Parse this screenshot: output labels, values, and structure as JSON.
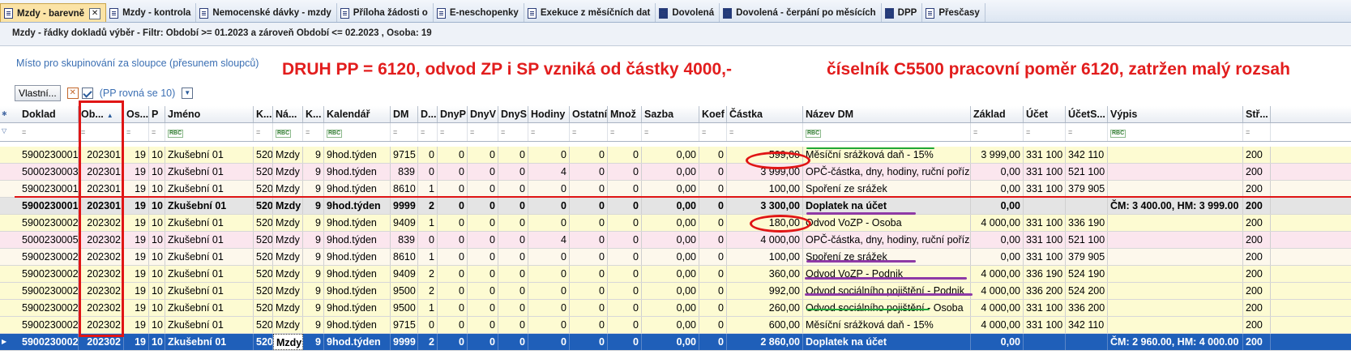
{
  "tabs": [
    {
      "label": "Mzdy - barevně",
      "active": true,
      "closable": true
    },
    {
      "label": "Mzdy - kontrola"
    },
    {
      "label": "Nemocenské dávky - mzdy"
    },
    {
      "label": "Příloha žádosti o"
    },
    {
      "label": "E-neschopenky"
    },
    {
      "label": "Exekuce z měsíčních dat"
    },
    {
      "label": "Dovolená"
    },
    {
      "label": "Dovolená - čerpání po měsících"
    },
    {
      "label": "DPP"
    },
    {
      "label": "Přesčasy"
    }
  ],
  "filter_line": "Mzdy - řádky dokladů výběr -  Filtr: Období >= 01.2023  a zároveň  Období <= 02.2023 , Osoba: 19",
  "group_zone": "Místo pro skupinování za sloupce (přesunem sloupců)",
  "annotations": {
    "note1": "DRUH PP = 6120, odvod ZP i SP vzniká od částky 4000,-",
    "note2": "číselník C5500 pracovní poměr 6120, zatržen malý rozsah"
  },
  "filterbar": {
    "custom_label": "Vlastní...",
    "clear_icon": "x-icon",
    "filter_text": "(PP rovná se 10)"
  },
  "columns": [
    "Doklad",
    "Ob...",
    "Os...",
    "P",
    "Jméno",
    "K...",
    "Ná...",
    "K...",
    "Kalendář",
    "DM",
    "D...",
    "DnyP",
    "DnyV",
    "DnyS",
    "Hodiny",
    "Ostatní",
    "Množ",
    "Sazba",
    "Koef",
    "Částka",
    "Název DM",
    "Základ",
    "Účet",
    "ÚčetS...",
    "Výpis",
    "Stř..."
  ],
  "sort": {
    "column": "Ob...",
    "direction": "ascending"
  },
  "filter_row_eq": "=",
  "filter_row_abc": "RBC",
  "rows": [
    {
      "style": "y",
      "cells": [
        "5900230001",
        "202301",
        "19",
        "10",
        "Zkušební 01",
        "520",
        "Mzdy",
        "9",
        "9hod.týden",
        "9715",
        "0",
        "0",
        "0",
        "0",
        "0",
        "0",
        "0",
        "0,00",
        "0",
        "599,00",
        "Měsíční srážková daň - 15%",
        "3 999,00",
        "331 100",
        "342 110",
        "",
        "200"
      ]
    },
    {
      "style": "p",
      "cells": [
        "5000230003",
        "202301",
        "19",
        "10",
        "Zkušební 01",
        "520",
        "Mzdy",
        "9",
        "9hod.týden",
        "839",
        "0",
        "0",
        "0",
        "0",
        "4",
        "0",
        "0",
        "0,00",
        "0",
        "3 999,00",
        "OPČ-částka, dny, hodiny, ruční pořízení",
        "0,00",
        "331 100",
        "521 100",
        "",
        "200"
      ]
    },
    {
      "style": "c",
      "cells": [
        "5900230001",
        "202301",
        "19",
        "10",
        "Zkušební 01",
        "520",
        "Mzdy",
        "9",
        "9hod.týden",
        "8610",
        "1",
        "0",
        "0",
        "0",
        "0",
        "0",
        "0",
        "0,00",
        "0",
        "100,00",
        "Spoření ze srážek",
        "0,00",
        "331 100",
        "379 905",
        "",
        "200"
      ]
    },
    {
      "style": "g",
      "cells": [
        "5900230001",
        "202301",
        "19",
        "10",
        "Zkušební 01",
        "520",
        "Mzdy",
        "9",
        "9hod.týden",
        "9999",
        "2",
        "0",
        "0",
        "0",
        "0",
        "0",
        "0",
        "0,00",
        "0",
        "3 300,00",
        "Doplatek na účet",
        "0,00",
        "",
        "",
        "ČM: 3 400.00, HM: 3 999.00",
        "200"
      ]
    },
    {
      "style": "y",
      "cells": [
        "5900230002",
        "202302",
        "19",
        "10",
        "Zkušební 01",
        "520",
        "Mzdy",
        "9",
        "9hod.týden",
        "9409",
        "1",
        "0",
        "0",
        "0",
        "0",
        "0",
        "0",
        "0,00",
        "0",
        "180,00",
        "Odvod VoZP - Osoba",
        "4 000,00",
        "331 100",
        "336 190",
        "",
        "200"
      ]
    },
    {
      "style": "p",
      "cells": [
        "5000230005",
        "202302",
        "19",
        "10",
        "Zkušební 01",
        "520",
        "Mzdy",
        "9",
        "9hod.týden",
        "839",
        "0",
        "0",
        "0",
        "0",
        "4",
        "0",
        "0",
        "0,00",
        "0",
        "4 000,00",
        "OPČ-částka, dny, hodiny, ruční pořízení",
        "0,00",
        "331 100",
        "521 100",
        "",
        "200"
      ]
    },
    {
      "style": "c",
      "cells": [
        "5900230002",
        "202302",
        "19",
        "10",
        "Zkušební 01",
        "520",
        "Mzdy",
        "9",
        "9hod.týden",
        "8610",
        "1",
        "0",
        "0",
        "0",
        "0",
        "0",
        "0",
        "0,00",
        "0",
        "100,00",
        "Spoření ze srážek",
        "0,00",
        "331 100",
        "379 905",
        "",
        "200"
      ]
    },
    {
      "style": "y",
      "cells": [
        "5900230002",
        "202302",
        "19",
        "10",
        "Zkušební 01",
        "520",
        "Mzdy",
        "9",
        "9hod.týden",
        "9409",
        "2",
        "0",
        "0",
        "0",
        "0",
        "0",
        "0",
        "0,00",
        "0",
        "360,00",
        "Odvod VoZP - Podnik",
        "4 000,00",
        "336 190",
        "524 190",
        "",
        "200"
      ]
    },
    {
      "style": "y",
      "cells": [
        "5900230002",
        "202302",
        "19",
        "10",
        "Zkušební 01",
        "520",
        "Mzdy",
        "9",
        "9hod.týden",
        "9500",
        "2",
        "0",
        "0",
        "0",
        "0",
        "0",
        "0",
        "0,00",
        "0",
        "992,00",
        "Odvod sociálního pojištění - Podnik",
        "4 000,00",
        "336 200",
        "524 200",
        "",
        "200"
      ]
    },
    {
      "style": "y",
      "cells": [
        "5900230002",
        "202302",
        "19",
        "10",
        "Zkušební 01",
        "520",
        "Mzdy",
        "9",
        "9hod.týden",
        "9500",
        "1",
        "0",
        "0",
        "0",
        "0",
        "0",
        "0",
        "0,00",
        "0",
        "260,00",
        "Odvod sociálního pojištění - Osoba",
        "4 000,00",
        "331 100",
        "336 200",
        "",
        "200"
      ]
    },
    {
      "style": "y",
      "cells": [
        "5900230002",
        "202302",
        "19",
        "10",
        "Zkušební 01",
        "520",
        "Mzdy",
        "9",
        "9hod.týden",
        "9715",
        "0",
        "0",
        "0",
        "0",
        "0",
        "0",
        "0",
        "0,00",
        "0",
        "600,00",
        "Měsíční srážková daň - 15%",
        "4 000,00",
        "331 100",
        "342 110",
        "",
        "200"
      ]
    },
    {
      "style": "sel",
      "cells": [
        "5900230002",
        "202302",
        "19",
        "10",
        "Zkušební 01",
        "520",
        "Mzdy",
        "9",
        "9hod.týden",
        "9999",
        "2",
        "0",
        "0",
        "0",
        "0",
        "0",
        "0",
        "0,00",
        "0",
        "2 860,00",
        "Doplatek na účet",
        "0,00",
        "",
        "",
        "ČM: 2 960.00, HM: 4 000.00",
        "200"
      ]
    }
  ],
  "colors": {
    "accent_red": "#e01515",
    "underline_purple": "#8e3aa6",
    "underline_green": "#1fa83a",
    "selection_blue": "#1f5fb9",
    "row_yellow": "#fdfbd2",
    "row_pink": "#fbe6ee",
    "row_summary": "#e4e4e4"
  }
}
